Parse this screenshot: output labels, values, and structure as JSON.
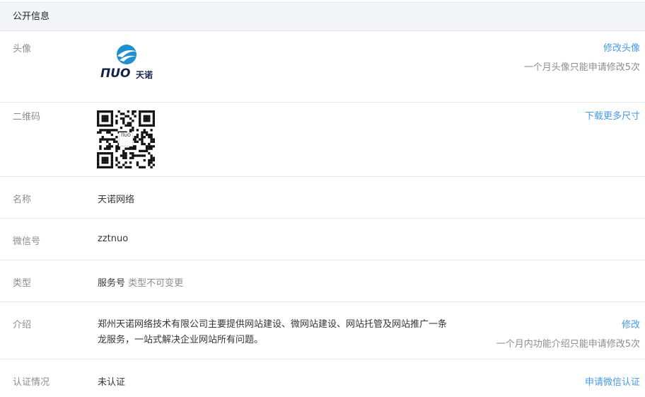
{
  "section": {
    "title": "公开信息"
  },
  "avatar": {
    "label": "头像",
    "logo_word": "ΠUO",
    "logo_cn": "天诺",
    "action": "修改头像",
    "note": "一个月头像只能申请修改5次"
  },
  "qrcode": {
    "label": "二维码",
    "center_text": "ΠUO",
    "action": "下载更多尺寸"
  },
  "name": {
    "label": "名称",
    "value": "天诺网络"
  },
  "wechat_id": {
    "label": "微信号",
    "value": "zztnuo"
  },
  "type": {
    "label": "类型",
    "value": "服务号",
    "note": "类型不可变更"
  },
  "intro": {
    "label": "介绍",
    "line1": "郑州天诺网络技术有限公司主要提供网站建设、微网站建设、网站托管及网站推广一条",
    "line2": "龙服务，一站式解决企业网站所有问题。",
    "action": "修改",
    "note": "一个月内功能介绍只能申请修改5次"
  },
  "verify": {
    "label": "认证情况",
    "value": "未认证",
    "action": "申请微信认证"
  },
  "colors": {
    "link": "#459ae9",
    "label": "#8d8d8d",
    "logo_blue": "#1f8fd0",
    "logo_navy": "#14224a"
  },
  "icons": {
    "logo_mark": "globe-bird-logo-icon"
  }
}
